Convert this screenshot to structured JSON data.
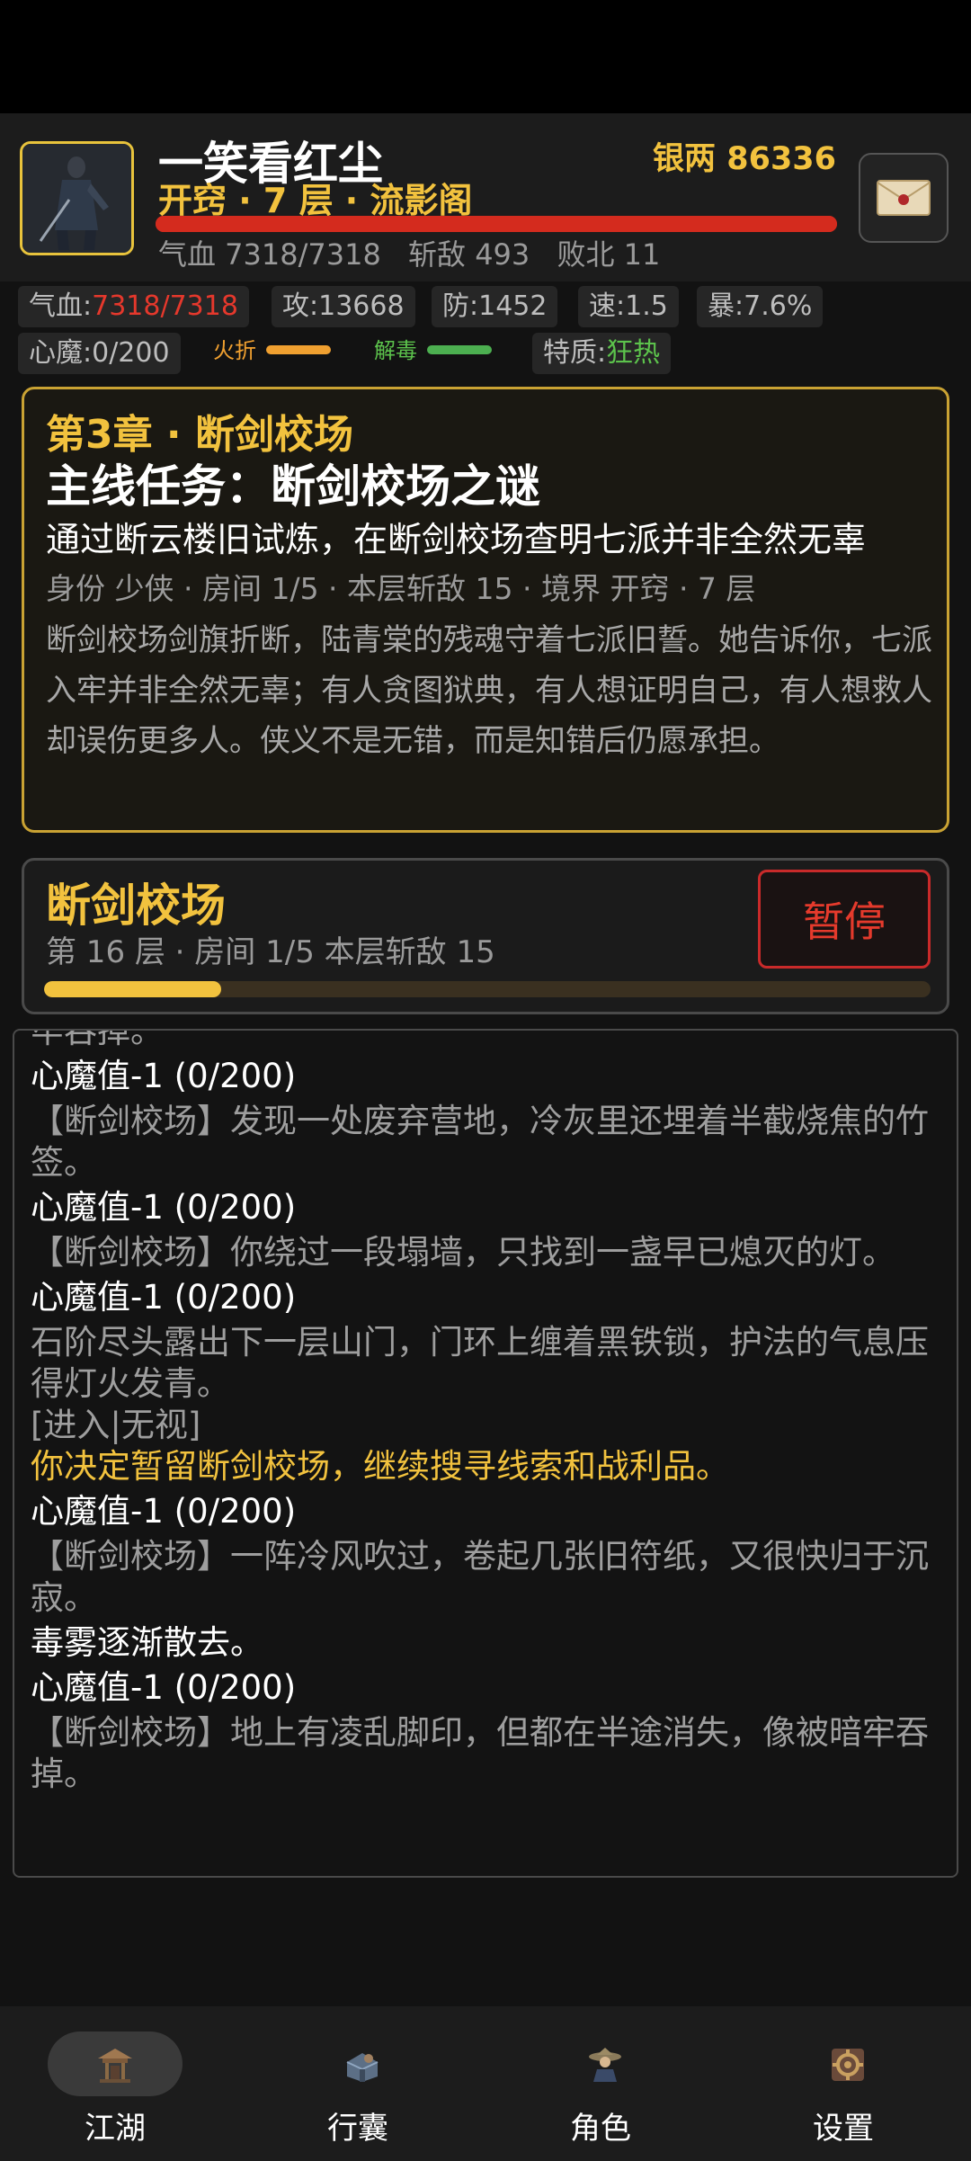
{
  "header": {
    "name": "一笑看红尘",
    "realm": "开窍 · 7 层 · 流影阁",
    "silver_label": "银两 86336",
    "hp_fraction": 1.0,
    "stats": [
      "气血 7318/7318",
      "斩敌 493",
      "败北 11"
    ]
  },
  "chips": {
    "hp_label": "气血:",
    "hp_value": "7318/7318",
    "atk": "攻:13668",
    "def": "防:1452",
    "spd": "速:1.5",
    "crit": "暴:7.6%",
    "demon": "心魔:0/200",
    "fire_label": "火折",
    "detox_label": "解毒",
    "trait_label": "特质:",
    "trait_value": "狂热"
  },
  "quest": {
    "chapter": "第3章 · 断剑校场",
    "title": "主线任务：断剑校场之谜",
    "goal": "通过断云楼旧试炼，在断剑校场查明七派并非全然无辜",
    "info": "身份 少侠 · 房间 1/5 · 本层斩敌 15 · 境界 开窍 · 7 层",
    "desc": "断剑校场剑旗折断，陆青棠的残魂守着七派旧誓。她告诉你，七派入牢并非全然无辜；有人贪图狱典，有人想证明自己，有人想救人却误伤更多人。侠义不是无错，而是知错后仍愿承担。"
  },
  "dungeon": {
    "name": "断剑校场",
    "info": "第 16 层 · 房间 1/5   本层斩敌 15",
    "pause_label": "暂停",
    "progress_fraction": 0.2
  },
  "log": [
    {
      "text": "牢吞掉。",
      "style": "gray"
    },
    {
      "text": "心魔值-1 (0/200)",
      "style": "white"
    },
    {
      "text": "【断剑校场】发现一处废弃营地，冷灰里还埋着半截烧焦的竹签。",
      "style": "gray"
    },
    {
      "text": "心魔值-1 (0/200)",
      "style": "white"
    },
    {
      "text": "【断剑校场】你绕过一段塌墙，只找到一盏早已熄灭的灯。",
      "style": "gray"
    },
    {
      "text": "心魔值-1 (0/200)",
      "style": "white"
    },
    {
      "text": "石阶尽头露出下一层山门，门环上缠着黑铁锁，护法的气息压得灯火发青。",
      "style": "gray"
    },
    {
      "text": "[进入|无视]",
      "style": "gray"
    },
    {
      "text": "你决定暂留断剑校场，继续搜寻线索和战利品。",
      "style": "gold"
    },
    {
      "text": "心魔值-1 (0/200)",
      "style": "white"
    },
    {
      "text": "【断剑校场】一阵冷风吹过，卷起几张旧符纸，又很快归于沉寂。",
      "style": "gray"
    },
    {
      "text": "毒雾逐渐散去。",
      "style": "white"
    },
    {
      "text": "心魔值-1 (0/200)",
      "style": "white"
    },
    {
      "text": "【断剑校场】地上有凌乱脚印，但都在半途消失，像被暗牢吞掉。",
      "style": "gray"
    }
  ],
  "nav": {
    "items": [
      {
        "label": "江湖",
        "icon": "pavilion-icon"
      },
      {
        "label": "行囊",
        "icon": "bag-icon"
      },
      {
        "label": "角色",
        "icon": "character-icon"
      },
      {
        "label": "设置",
        "icon": "settings-icon"
      }
    ]
  },
  "colors": {
    "accent_gold": "#f2c23e",
    "hp_red": "#d42b1e",
    "danger": "#e53a2c",
    "green": "#5cc24c",
    "fire_bar": "#f0a030",
    "detox_bar": "#4caf50"
  }
}
